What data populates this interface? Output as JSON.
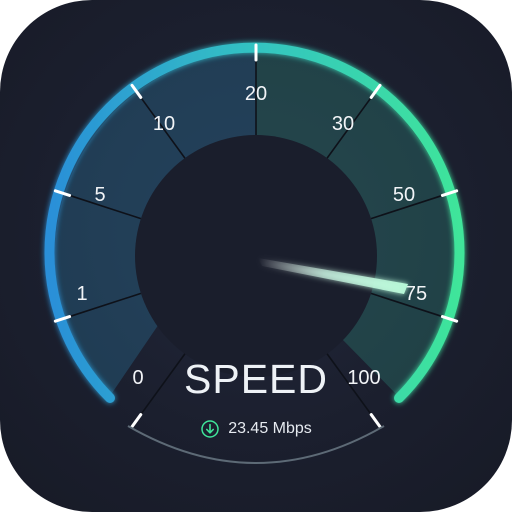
{
  "gauge": {
    "title": "SPEED",
    "reading": {
      "value_text": "23.45 Mbps",
      "icon": "download-arrow-icon"
    },
    "scale_labels": [
      "0",
      "1",
      "5",
      "10",
      "20",
      "30",
      "50",
      "75",
      "100"
    ],
    "needle_position_label": "75",
    "colors": {
      "arc_start": "#2a8fd8",
      "arc_mid": "#33c3c2",
      "arc_end": "#3fe59a",
      "background": "#1b1f2e",
      "text": "#f2f4f7"
    }
  }
}
